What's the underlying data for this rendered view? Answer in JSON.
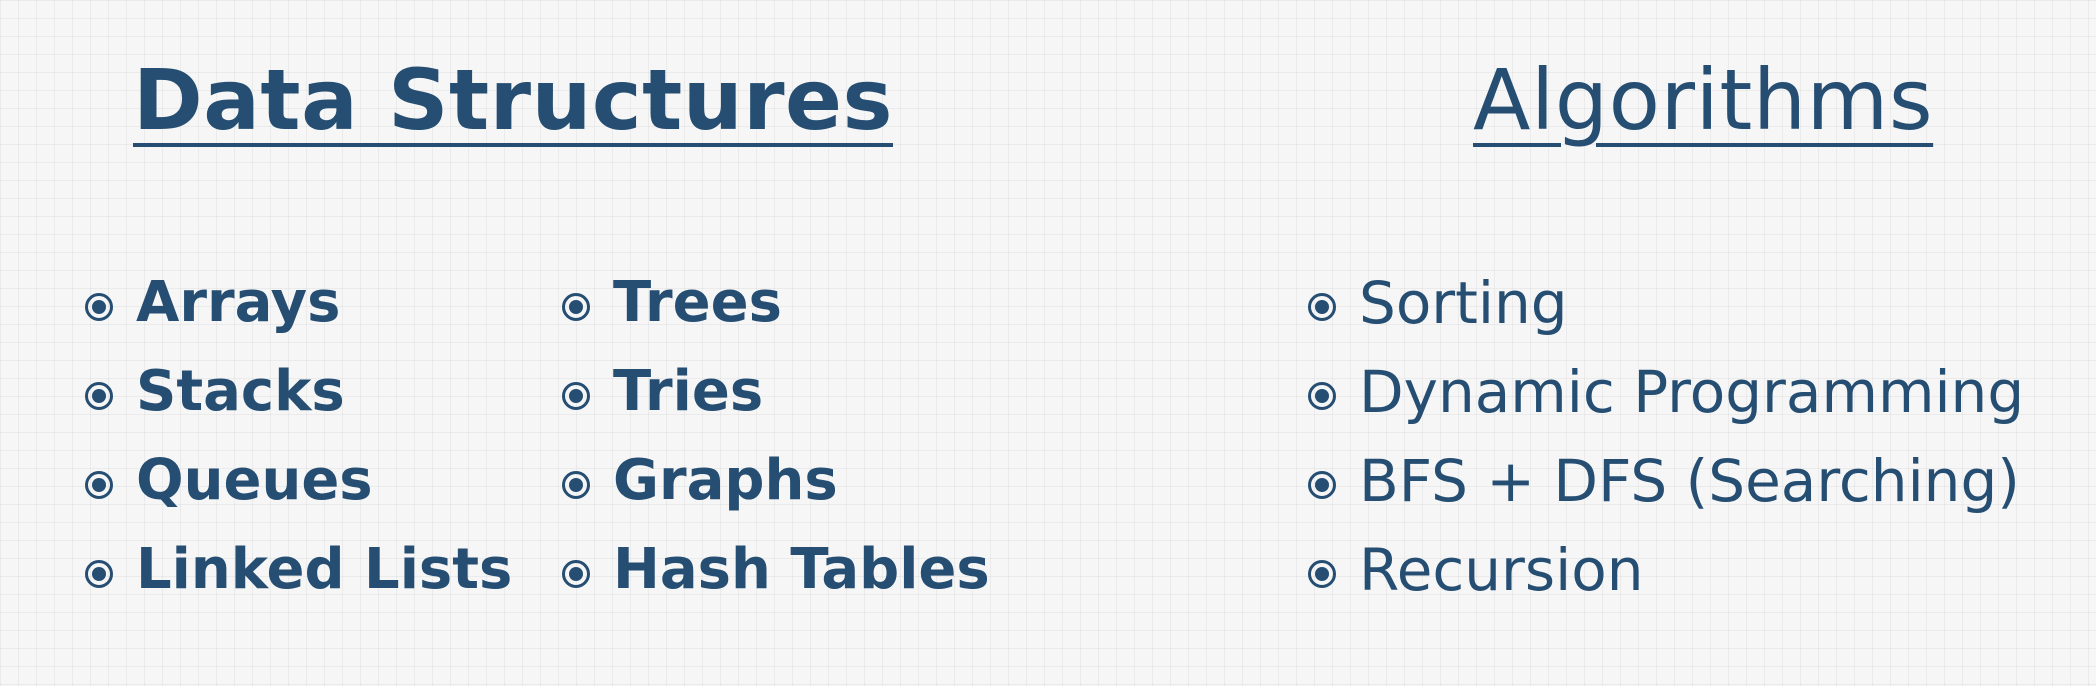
{
  "data_structures": {
    "title": "Data Structures",
    "column_1": [
      "Arrays",
      "Stacks",
      "Queues",
      "Linked Lists"
    ],
    "column_2": [
      "Trees",
      "Tries",
      "Graphs",
      "Hash Tables"
    ]
  },
  "algorithms": {
    "title": "Algorithms",
    "items": [
      "Sorting",
      "Dynamic Programming",
      "BFS + DFS (Searching)",
      "Recursion"
    ]
  },
  "colors": {
    "text": "#254e72",
    "background": "#f6f6f6",
    "grid": "#e4e4e4"
  },
  "icons": {
    "bullet": "radio-bullet-icon"
  }
}
